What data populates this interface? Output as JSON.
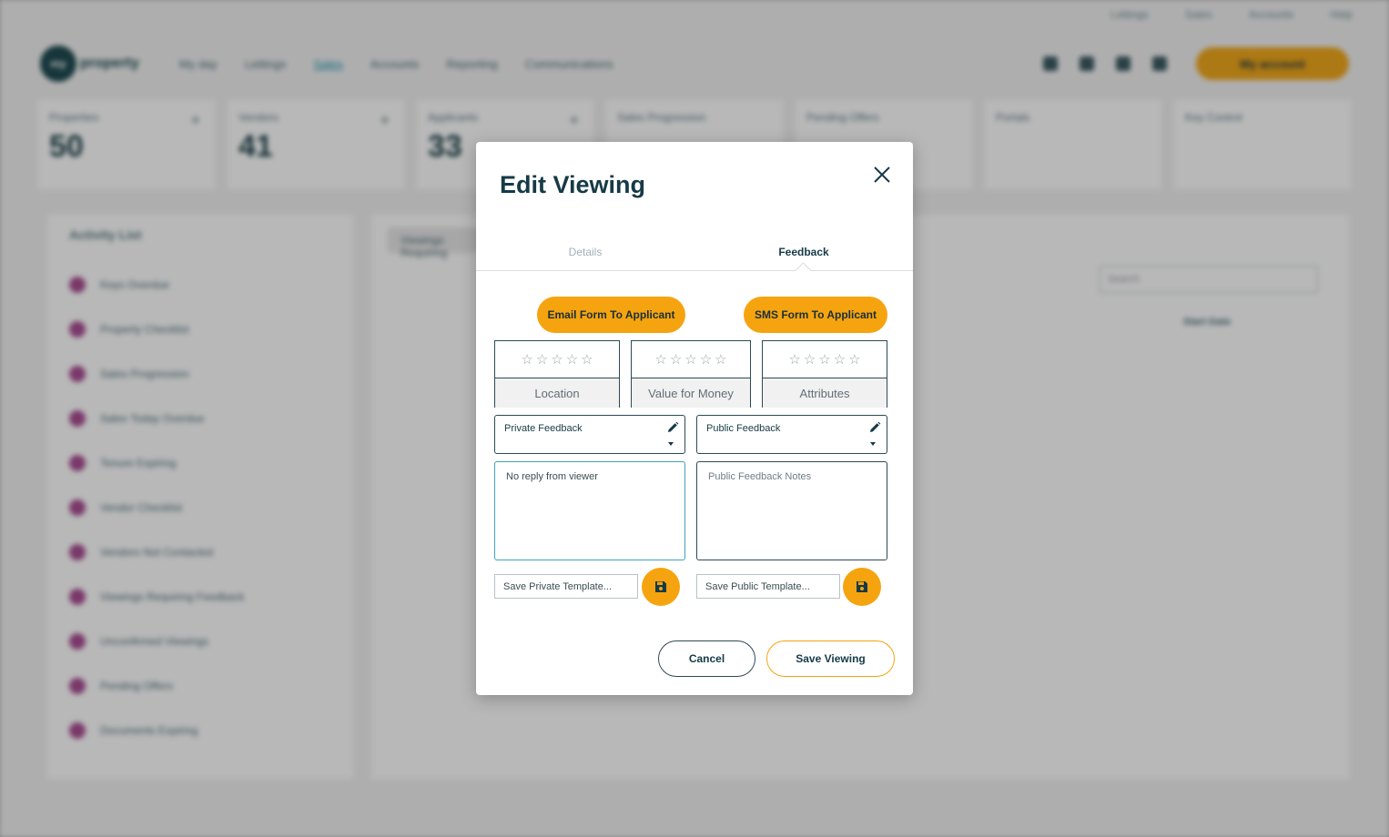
{
  "background": {
    "util_links": [
      "Lettings",
      "Sales",
      "Accounts",
      "Help"
    ],
    "logo_text": "property",
    "menu": [
      "My day",
      "Lettings",
      "Sales",
      "Accounts",
      "Reporting",
      "Communications"
    ],
    "account_label": "My account",
    "stats": [
      {
        "label": "Properties",
        "value": "50"
      },
      {
        "label": "Vendors",
        "value": "41"
      },
      {
        "label": "Applicants",
        "value": "33"
      },
      {
        "label": "Sales Progression",
        "value": ""
      },
      {
        "label": "Pending Offers",
        "value": ""
      },
      {
        "label": "Portals",
        "value": ""
      },
      {
        "label": "Key Control",
        "value": ""
      }
    ],
    "activity_title": "Activity List",
    "activity_items": [
      "Keys Overdue",
      "Property Checklist",
      "Sales Progression",
      "Sales Today Overdue",
      "Tenure Expiring",
      "Vendor Checklist",
      "Vendors Not Contacted",
      "Viewings Requiring Feedback",
      "Unconfirmed Viewings",
      "Pending Offers",
      "Documents Expiring"
    ],
    "tab_chip": "Viewings Requiring",
    "search_placeholder": "Search",
    "date_col_head": "Start Date"
  },
  "modal": {
    "title": "Edit Viewing",
    "tabs": {
      "details": "Details",
      "feedback": "Feedback"
    },
    "email_form_button": "Email Form To Applicant",
    "sms_form_button": "SMS Form To Applicant",
    "ratings": [
      {
        "label": "Location",
        "stars": 0,
        "max": 5
      },
      {
        "label": "Value for Money",
        "stars": 0,
        "max": 5
      },
      {
        "label": "Attributes",
        "stars": 0,
        "max": 5
      }
    ],
    "private_feedback_label": "Private Feedback",
    "public_feedback_label": "Public Feedback",
    "private_notes_value": "No reply from viewer",
    "public_notes_placeholder": "Public Feedback Notes",
    "private_template_placeholder": "Save Private Template...",
    "public_template_placeholder": "Save Public Template...",
    "cancel_label": "Cancel",
    "save_label": "Save Viewing"
  },
  "colors": {
    "accent": "#f5a410",
    "primary_text": "#163a46",
    "focus_border": "#3ea3bf"
  },
  "icons": {
    "close": "close-icon",
    "pencil": "pencil-icon",
    "save": "floppy-disk-icon",
    "star": "star-outline-icon"
  }
}
